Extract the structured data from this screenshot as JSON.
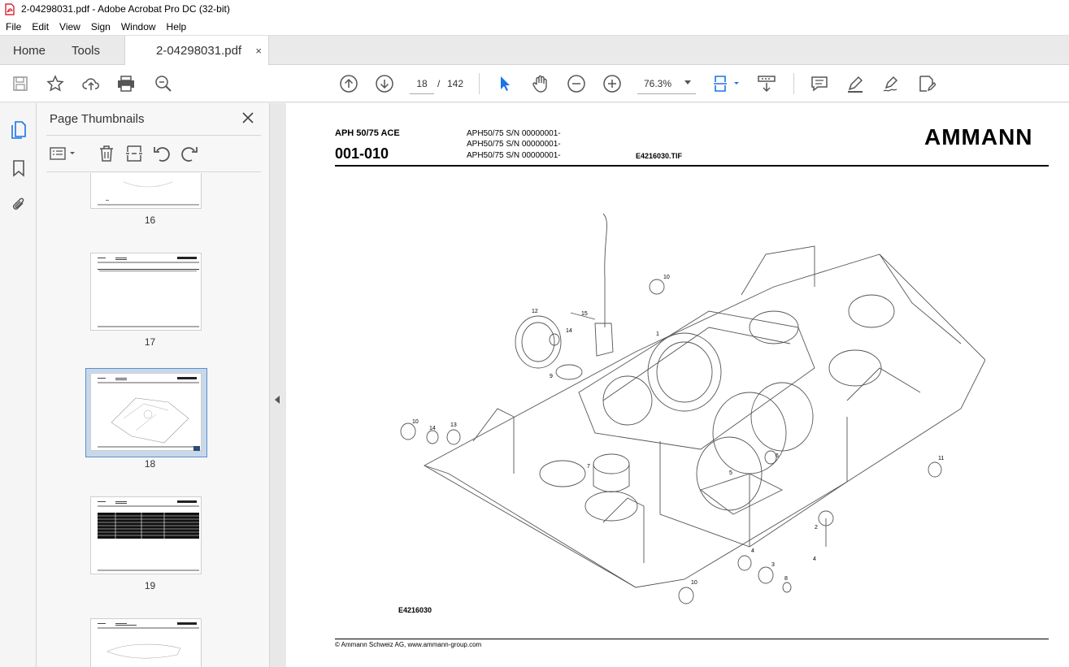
{
  "window": {
    "title": "2-04298031.pdf - Adobe Acrobat Pro DC (32-bit)"
  },
  "menu": {
    "items": [
      "File",
      "Edit",
      "View",
      "Sign",
      "Window",
      "Help"
    ]
  },
  "tabs": {
    "home": "Home",
    "tools": "Tools",
    "document": "2-04298031.pdf",
    "close_glyph": "×"
  },
  "toolbar": {
    "current_page": "18",
    "page_separator": "/",
    "total_pages": "142",
    "zoom": "76.3%"
  },
  "thumbnail_panel": {
    "title": "Page Thumbnails",
    "pages": [
      {
        "label": "16"
      },
      {
        "label": "17"
      },
      {
        "label": "18",
        "selected": true
      },
      {
        "label": "19"
      }
    ]
  },
  "document": {
    "model": "APH 50/75 ACE",
    "code": "001-010",
    "serials": [
      "APH50/75 S/N 00000001-",
      "APH50/75 S/N 00000001-",
      "APH50/75 S/N 00000001-"
    ],
    "image_file": "E4216030.TIF",
    "logo": "AMMANN",
    "figure_id": "E4216030",
    "footer": "© Ammann Schweiz AG, www.ammann-group.com",
    "callouts": [
      "1",
      "2",
      "3",
      "4",
      "4",
      "5",
      "6",
      "7",
      "8",
      "9",
      "10",
      "10",
      "10",
      "11",
      "12",
      "13",
      "14",
      "14",
      "15"
    ]
  },
  "colors": {
    "accent": "#2a6ebb",
    "icon": "#555555",
    "tool_blue": "#1a73e8"
  }
}
